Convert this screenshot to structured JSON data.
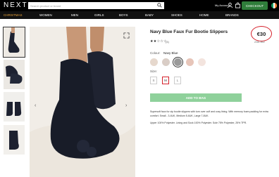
{
  "header": {
    "logo": "NEXT",
    "search_placeholder": "Search product or brand",
    "account_label": "My Account",
    "checkout_label": "CHECKOUT"
  },
  "nav": {
    "items": [
      {
        "label": "CHRISTMAS",
        "active": true
      },
      {
        "label": "WOMEN"
      },
      {
        "label": "MEN"
      },
      {
        "label": "GIRLS"
      },
      {
        "label": "BOYS"
      },
      {
        "label": "BABY"
      },
      {
        "label": "SHOES"
      },
      {
        "label": "HOME"
      },
      {
        "label": "BRANDS"
      }
    ]
  },
  "product": {
    "title": "Navy Blue Faux Fur Bootie Slippers",
    "price": "€30",
    "code": "236-162",
    "stars": "★★☆☆☆",
    "reviews": "(4)",
    "colour_label": "Colour:",
    "colour_value": "Navy Blue",
    "swatch_colors": [
      "#e6d8cd",
      "#d9cdc6",
      "#9a9a9a",
      "#e7c5b9",
      "#f3e4de"
    ],
    "size_label": "Size:",
    "sizes": [
      "S",
      "M",
      "L"
    ],
    "selected_size": "M",
    "add_to_bag_label": "ADD TO BAG",
    "description": "Supersoft faux fur zip bootie slippers with turn over cuff and cosy lining. With memory foam padding for extra comfort. Small - 3-4UK, Medium 5-6UK, Large 7-8UK.",
    "composition": "Upper 100% Polyester. Lining and Sock 100% Polyester. Sole 75% Polyester, 25% TPR."
  },
  "colors": {
    "checkout_green": "#2f7d3a",
    "price_circle": "#d5202a",
    "add_to_bag_bg": "#8fd19b",
    "active_nav": "#e8a23a"
  }
}
